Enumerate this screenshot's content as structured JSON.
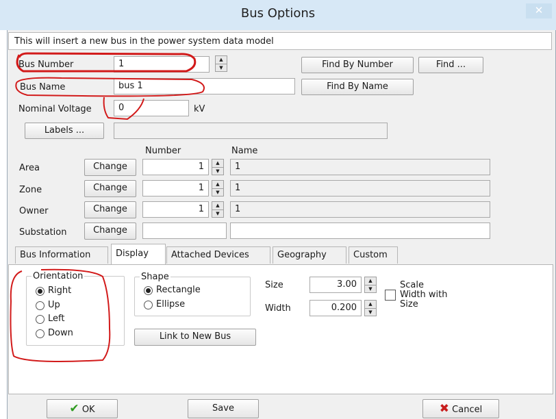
{
  "window": {
    "title": "Bus Options",
    "close_glyph": "✕"
  },
  "info_text": "This will insert a new bus in the power system data model",
  "bus_number": {
    "label": "Bus Number",
    "value": "1"
  },
  "bus_name": {
    "label": "Bus Name",
    "value": "bus 1"
  },
  "nominal_voltage": {
    "label": "Nominal Voltage",
    "value": "0",
    "unit": "kV"
  },
  "buttons": {
    "find_by_number": "Find By Number",
    "find": "Find ...",
    "find_by_name": "Find By Name",
    "labels": "Labels ...",
    "change": "Change",
    "link_to_new_bus": "Link to New Bus",
    "ok": "OK",
    "save": "Save",
    "cancel": "Cancel"
  },
  "labels_value": "",
  "grid": {
    "header_number": "Number",
    "header_name": "Name",
    "rows": [
      {
        "label": "Area",
        "number": "1",
        "name": "1"
      },
      {
        "label": "Zone",
        "number": "1",
        "name": "1"
      },
      {
        "label": "Owner",
        "number": "1",
        "name": "1"
      },
      {
        "label": "Substation",
        "number": "",
        "name": ""
      }
    ]
  },
  "tabs": [
    "Bus Information",
    "Display",
    "Attached Devices",
    "Geography",
    "Custom"
  ],
  "active_tab": "Display",
  "orientation": {
    "title": "Orientation",
    "options": [
      "Right",
      "Up",
      "Left",
      "Down"
    ],
    "selected": "Right"
  },
  "shape": {
    "title": "Shape",
    "options": [
      "Rectangle",
      "Ellipse"
    ],
    "selected": "Rectangle"
  },
  "size": {
    "label": "Size",
    "value": "3.00"
  },
  "width": {
    "label": "Width",
    "value": "0.200"
  },
  "scale_width_with_size": {
    "line1": "Scale",
    "line2": "Width with",
    "line3": "Size",
    "checked": false
  },
  "colors": {
    "annotation": "#d21a1a",
    "ok_check": "#2e9b1f",
    "cancel_x": "#c81e1e",
    "titlebar": "#d7e8f6"
  }
}
